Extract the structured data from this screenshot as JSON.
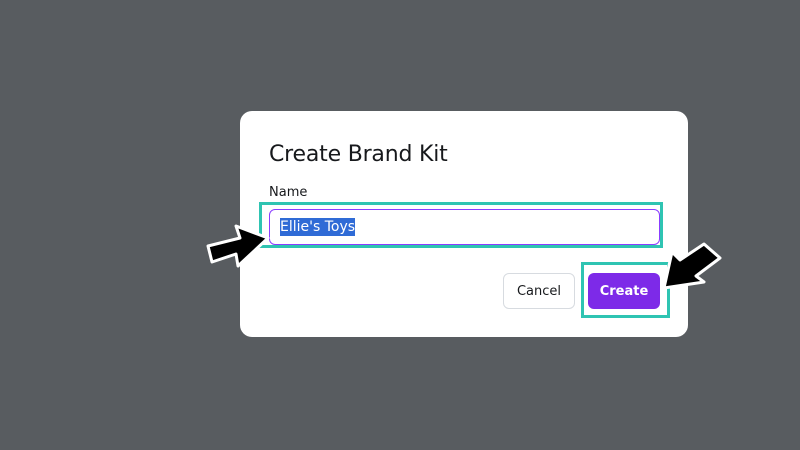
{
  "dialog": {
    "title": "Create Brand Kit",
    "name_label": "Name",
    "name_value": "Ellie's Toys",
    "cancel_label": "Cancel",
    "create_label": "Create"
  },
  "colors": {
    "backdrop": "#585c60",
    "accent": "#7d2ae8",
    "highlight": "#2fc4b2",
    "selection": "#2f6bd6"
  },
  "icons": {
    "annotation_arrow_left": "arrow-pointer-icon",
    "annotation_arrow_right": "arrow-pointer-icon"
  }
}
